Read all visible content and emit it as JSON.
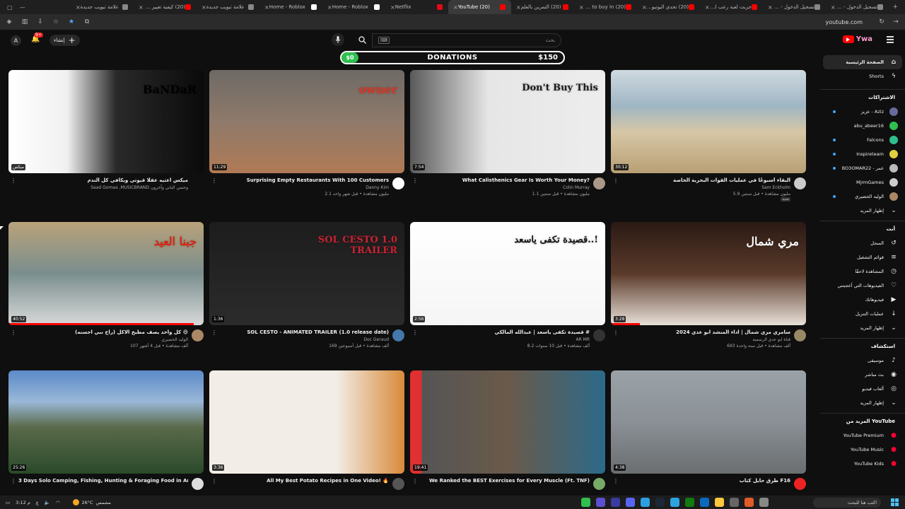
{
  "browser": {
    "tabs": [
      {
        "title": "علامة تبويب جديدة",
        "color": "#888"
      },
      {
        "title": "(20) كيفية تغيير رياح",
        "color": "#f00"
      },
      {
        "title": "علامة تبويب جديدة",
        "color": "#888"
      },
      {
        "title": "Home - Roblox",
        "color": "#fff"
      },
      {
        "title": "Home - Roblox",
        "color": "#fff"
      },
      {
        "title": "Netflix",
        "color": "#e50914"
      },
      {
        "title": "(20) YouTube",
        "color": "#f00",
        "active": true
      },
      {
        "title": "(20) التمرين بالعلم",
        "color": "#f00"
      },
      {
        "title": "(20) how to buy in",
        "color": "#f00"
      },
      {
        "title": "(20) تحدي اليوتيوبرز الرس",
        "color": "#f00"
      },
      {
        "title": "جربت لعبة رعب لفلك",
        "color": "#f00"
      },
      {
        "title": "تسجيل الدخول - ملف",
        "color": "#888"
      },
      {
        "title": "تسجيل الدخول - ملف",
        "color": "#888"
      }
    ],
    "url": "youtube.com"
  },
  "header": {
    "account_initial": "A",
    "notifications_count": "9+",
    "create_label": "إنشاء",
    "search_placeholder": "بحث",
    "keyboard_icon": "⌨",
    "logo_word": "Ywa"
  },
  "donation": {
    "raised": "$0",
    "title": "DONATIONS",
    "goal": "$150",
    "progress_fraction": 0
  },
  "videos": [
    {
      "title": "البقاء أسبوعًا في عمليات القوات البحرية الخاصة",
      "channel": "Sam Eckholm",
      "stats": "5.9 مليون مشاهدة • قبل سنتين",
      "duration": "30:12",
      "thumb_bg": "linear-gradient(180deg,#cfd9e0 0%,#9fb6c4 35%,#d7c7a6 60%,#b89f74 100%)",
      "accent": "#6b7a3a",
      "av": "#ccc",
      "badge": "جديد",
      "progress": 0
    },
    {
      "title": "What Calisthenics Gear Is Worth Your Money?",
      "channel": "Colin Murray",
      "stats": "1.1 مليون مشاهدة • قبل سنتين",
      "duration": "7:54",
      "thumb_bg": "linear-gradient(90deg,#5a5a5a 0%,#e6e6e6 40%,#ededed 100%)",
      "accent": "#1a1a1a",
      "av": "#a98",
      "progress": 0,
      "overlay": "Don't Buy This"
    },
    {
      "title": "Surprising Empty Restaurants With 100 Customers",
      "channel": "Danny Kim",
      "stats": "2.1 مليون مشاهدة • قبل شهر واحد",
      "duration": "11:29",
      "thumb_bg": "linear-gradient(180deg,#6e6a66 0%,#8f7a6a 50%,#b07a55 100%)",
      "accent": "#d32",
      "av": "#fff",
      "progress": 0,
      "overlay": "owner"
    },
    {
      "title": "ميكس اعتيه عقلًا قيوتي ويكافي كل الندم",
      "channel": "Saad Gomaa ,MUSICBRAND وحسن الباني وآخرون",
      "stats": "",
      "duration": "ميكس",
      "thumb_bg": "linear-gradient(90deg,#ffffff 0%,#f0f0f0 30%,#2a2a2a 55%,#0a0a0a 100%)",
      "accent": "#000",
      "av": "",
      "progress": 0,
      "overlay": "BaNDaR"
    },
    {
      "title": "سامري مري شمال | اداء المنشد ابو عدي 2024",
      "channel": "قناة ابو عدي الرسمية",
      "stats": "693 ألف مشاهدة • قبل سنة واحدة",
      "duration": "3:28",
      "thumb_bg": "linear-gradient(180deg,#2a1a14 0%,#5a3a2a 50%,#e8e0d8 100%)",
      "accent": "#fff",
      "av": "#986",
      "progress": 0.15,
      "overlay": "مري شمال"
    },
    {
      "title": "قصيدة تكفى ياسعد | عبدالله المالكي #",
      "channel": "AR MR",
      "stats": "8.2 ألف مشاهدة • قبل 10 سنوات",
      "duration": "2:56",
      "thumb_bg": "linear-gradient(180deg,#ffffff 0%,#f5f5f5 100%)",
      "accent": "#111",
      "av": "#333",
      "progress": 0,
      "overlay": "قصيدة تكفى ياسعد..!"
    },
    {
      "title": "SOL CESTO - ANIMATED TRAILER (1.0 release date)",
      "channel": "Doc Geraud",
      "stats": "169 ألف مشاهدة • قبل أسبوعين",
      "duration": "1:36",
      "thumb_bg": "linear-gradient(180deg,#1d1d1d 0%,#2b2b2b 100%)",
      "accent": "#c23",
      "av": "#47a",
      "progress": 0,
      "overlay": "SOL CESTO 1.0 TRAILER"
    },
    {
      "title": "كل واحد يصف مطبخ الاكل (راح نبي احسنه) 😄",
      "channel": "الوليد الخضيري",
      "stats": "107 ألف مشاهدة • قبل 4 أشهر",
      "duration": "40:52",
      "thumb_bg": "linear-gradient(180deg,#b9a27a 0%,#7a8e8e 50%,#d9d9d9 100%)",
      "accent": "#d21",
      "av": "#a86",
      "progress": 0.95,
      "overlay": "جبنا العيد"
    },
    {
      "title": "طرق حايل كتاب F16",
      "channel": "",
      "stats": "",
      "duration": "4:38",
      "thumb_bg": "linear-gradient(180deg,#9aa2a8 0%,#8a9096 50%,#6a6e70 100%)",
      "accent": "#333",
      "av": "#e22",
      "progress": 0
    },
    {
      "title": "We Ranked the BEST Exercises for Every Muscle (Ft. TNF)",
      "channel": "",
      "stats": "",
      "duration": "19:41",
      "thumb_bg": "linear-gradient(90deg,#e03030 0%,#e03030 6%,#555 6%,#6a5a4a 50%,#2c6a8a 100%)",
      "accent": "#fff",
      "av": "#7a6",
      "progress": 0
    },
    {
      "title": "All My Best Potato Recipes in One Video! 🔥",
      "channel": "",
      "stats": "",
      "duration": "3:36",
      "thumb_bg": "linear-gradient(90deg,#f2ede6 0%,#f2ede6 65%,#d88a3a 100%)",
      "accent": "#c77",
      "av": "#555",
      "progress": 0
    },
    {
      "title": "3 Days Solo Camping, Fishing, Hunting & Foraging Food in Arctic",
      "channel": "",
      "stats": "",
      "duration": "25:26",
      "thumb_bg": "linear-gradient(180deg,#5a8ac8 0%,#9ab8d8 30%,#5a6a4a 55%,#2a4a2a 100%)",
      "accent": "#fff",
      "av": "#ddd",
      "progress": 0
    }
  ],
  "sidebar": {
    "main": [
      {
        "label": "الصفحة الرئيسية",
        "icon": "home-icon",
        "glyph": "⌂",
        "active": true
      },
      {
        "label": "Shorts",
        "icon": "shorts-icon",
        "glyph": "ϟ"
      }
    ],
    "subs_title": "الاشتراكات",
    "subs": [
      {
        "label": "عزيز - Aziz",
        "color": "#6a6a9a",
        "dot": true
      },
      {
        "label": "abu_abeer16",
        "color": "#2fbf4f",
        "dot": false
      },
      {
        "label": "Falcons",
        "color": "#2fbf8f",
        "dot": true
      },
      {
        "label": "Inspireteam",
        "color": "#e0d040",
        "dot": true
      },
      {
        "label": "BO3OMAR22 - عمر",
        "color": "#bbb",
        "dot": true
      },
      {
        "label": "MjrmGames",
        "color": "#ccc",
        "dot": false
      },
      {
        "label": "الوليد الخضيري",
        "color": "#a86",
        "dot": true
      },
      {
        "label": "إظهار المزيد",
        "color": "",
        "dot": false
      }
    ],
    "you_title": "أنت",
    "you": [
      {
        "label": "السجل",
        "icon": "history-icon",
        "glyph": "↺"
      },
      {
        "label": "قوائم التشغيل",
        "icon": "playlists-icon",
        "glyph": "≡"
      },
      {
        "label": "المشاهدة لاحقًا",
        "icon": "watch-later-icon",
        "glyph": "◷"
      },
      {
        "label": "الفيديوهات التي أعجبتني",
        "icon": "like-icon",
        "glyph": "♡"
      },
      {
        "label": "فيديوهاتك",
        "icon": "your-videos-icon",
        "glyph": "▶"
      },
      {
        "label": "عمليات التنزيل",
        "icon": "download-icon",
        "glyph": "↓"
      },
      {
        "label": "إظهار المزيد",
        "icon": "chevron-down-icon",
        "glyph": "⌄"
      }
    ],
    "explore_title": "استكشاف",
    "explore": [
      {
        "label": "موسيقى",
        "icon": "music-icon",
        "glyph": "♪"
      },
      {
        "label": "بث مباشر",
        "icon": "live-icon",
        "glyph": "◉"
      },
      {
        "label": "ألعاب فيديو",
        "icon": "gaming-icon",
        "glyph": "◎"
      },
      {
        "label": "إظهار المزيد",
        "icon": "chevron-down-icon",
        "glyph": "⌄"
      }
    ],
    "more_title": "المزيد من YouTube",
    "more": [
      {
        "label": "YouTube Premium",
        "icon": "premium-icon"
      },
      {
        "label": "YouTube Music",
        "icon": "music-app-icon"
      },
      {
        "label": "YouTube Kids",
        "icon": "kids-icon"
      }
    ]
  },
  "taskbar": {
    "temp": "26°C",
    "weather_text": "مشمس",
    "search_placeholder": "اكتب هنا للبحث",
    "time": "3:12 م"
  }
}
